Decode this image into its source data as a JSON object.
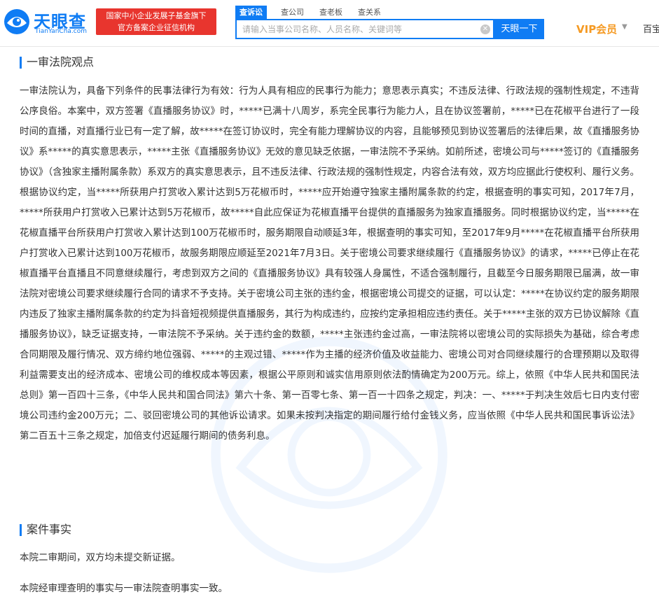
{
  "header": {
    "logo_name": "天眼查",
    "logo_sub": "TianYanCha.com",
    "badge_line1": "国家中小企业发展子基金旗下",
    "badge_line2": "官方备案企业征信机构",
    "tabs": [
      {
        "label": "查诉讼",
        "active": true
      },
      {
        "label": "查公司",
        "active": false
      },
      {
        "label": "查老板",
        "active": false
      },
      {
        "label": "查关系",
        "active": false
      }
    ],
    "search_placeholder": "请输入当事公司名称、人员名称、关键词等",
    "search_button": "天眼一下",
    "vip_label": "VIP会员",
    "vip_caret": "▼",
    "more_link": "百宝"
  },
  "colors": {
    "brand_blue": "#0f7cf4",
    "badge_red": "#e8352e",
    "vip_orange": "#f59a23"
  },
  "icons": {
    "logo": "tianyancha-eye-logo-icon",
    "clear": "clear-circle-icon",
    "caret": "caret-down-icon"
  },
  "sections": {
    "first_instance": {
      "title": "一审法院观点",
      "text": "一审法院认为，具备下列条件的民事法律行为有效：行为人具有相应的民事行为能力；意思表示真实；不违反法律、行政法规的强制性规定，不违背公序良俗。本案中，双方签署《直播服务协议》时，*****已满十八周岁，系完全民事行为能力人，且在协议签署前，*****已在花椒平台进行了一段时间的直播，对直播行业已有一定了解，故*****在签订协议时，完全有能力理解协议的内容，且能够预见到协议签署后的法律后果，故《直播服务协议》系*****的真实意思表示，*****主张《直播服务协议》无效的意见缺乏依据，一审法院不予采纳。如前所述，密境公司与*****签订的《直播服务协议》（含独家主播附属条款）系双方的真实意思表示，且不违反法律、行政法规的强制性规定，内容合法有效，双方均应据此行使权利、履行义务。根据协议约定，当*****所获用户打赏收入累计达到5万花椒币时，*****应开始遵守独家主播附属条款的约定，根据查明的事实可知，2017年7月，*****所获用户打赏收入已累计达到5万花椒币，故*****自此应保证为花椒直播平台提供的直播服务为独家直播服务。同时根据协议约定，当*****在花椒直播平台所获用户打赏收入累计达到100万花椒币时，服务期限自动顺延3年，根据查明的事实可知，至2017年9月*****在花椒直播平台所获用户打赏收入已累计达到100万花椒币，故服务期限应顺延至2021年7月3日。关于密境公司要求继续履行《直播服务协议》的请求，*****已停止在花椒直播平台直播且不同意继续履行，考虑到双方之间的《直播服务协议》具有较强人身属性，不适合强制履行，且截至今日服务期限已届满，故一审法院对密境公司要求继续履行合同的请求不予支持。关于密境公司主张的违约金，根据密境公司提交的证据，可以认定：*****在协议约定的服务期限内违反了独家主播附属条款的约定为抖音短视频提供直播服务，其行为构成违约，应按约定承担相应违约责任。关于*****主张的双方已协议解除《直播服务协议》，缺乏证据支持，一审法院不予采纳。关于违约金的数额，*****主张违约金过高，一审法院将以密境公司的实际损失为基础，综合考虑合同期限及履行情况、双方缔约地位强弱、*****的主观过错、*****作为主播的经济价值及收益能力、密境公司对合同继续履行的合理预期以及取得利益需要支出的经济成本、密境公司的维权成本等因素，根据公平原则和诚实信用原则依法酌情确定为200万元。综上，依照《中华人民共和国民法总则》第一百四十三条，《中华人民共和国合同法》第六十条、第一百零七条、第一百一十四条之规定，判决：一、*****于判决生效后七日内支付密境公司违约金200万元；二、驳回密境公司的其他诉讼请求。如果未按判决指定的期间履行给付金钱义务，应当依照《中华人民共和国民事诉讼法》第二百五十三条之规定，加倍支付迟延履行期间的债务利息。"
    },
    "case_facts": {
      "title": "案件事实",
      "line1": "本院二审期间，双方均未提交新证据。",
      "line2": "本院经审理查明的事实与一审法院查明事实一致。"
    }
  }
}
